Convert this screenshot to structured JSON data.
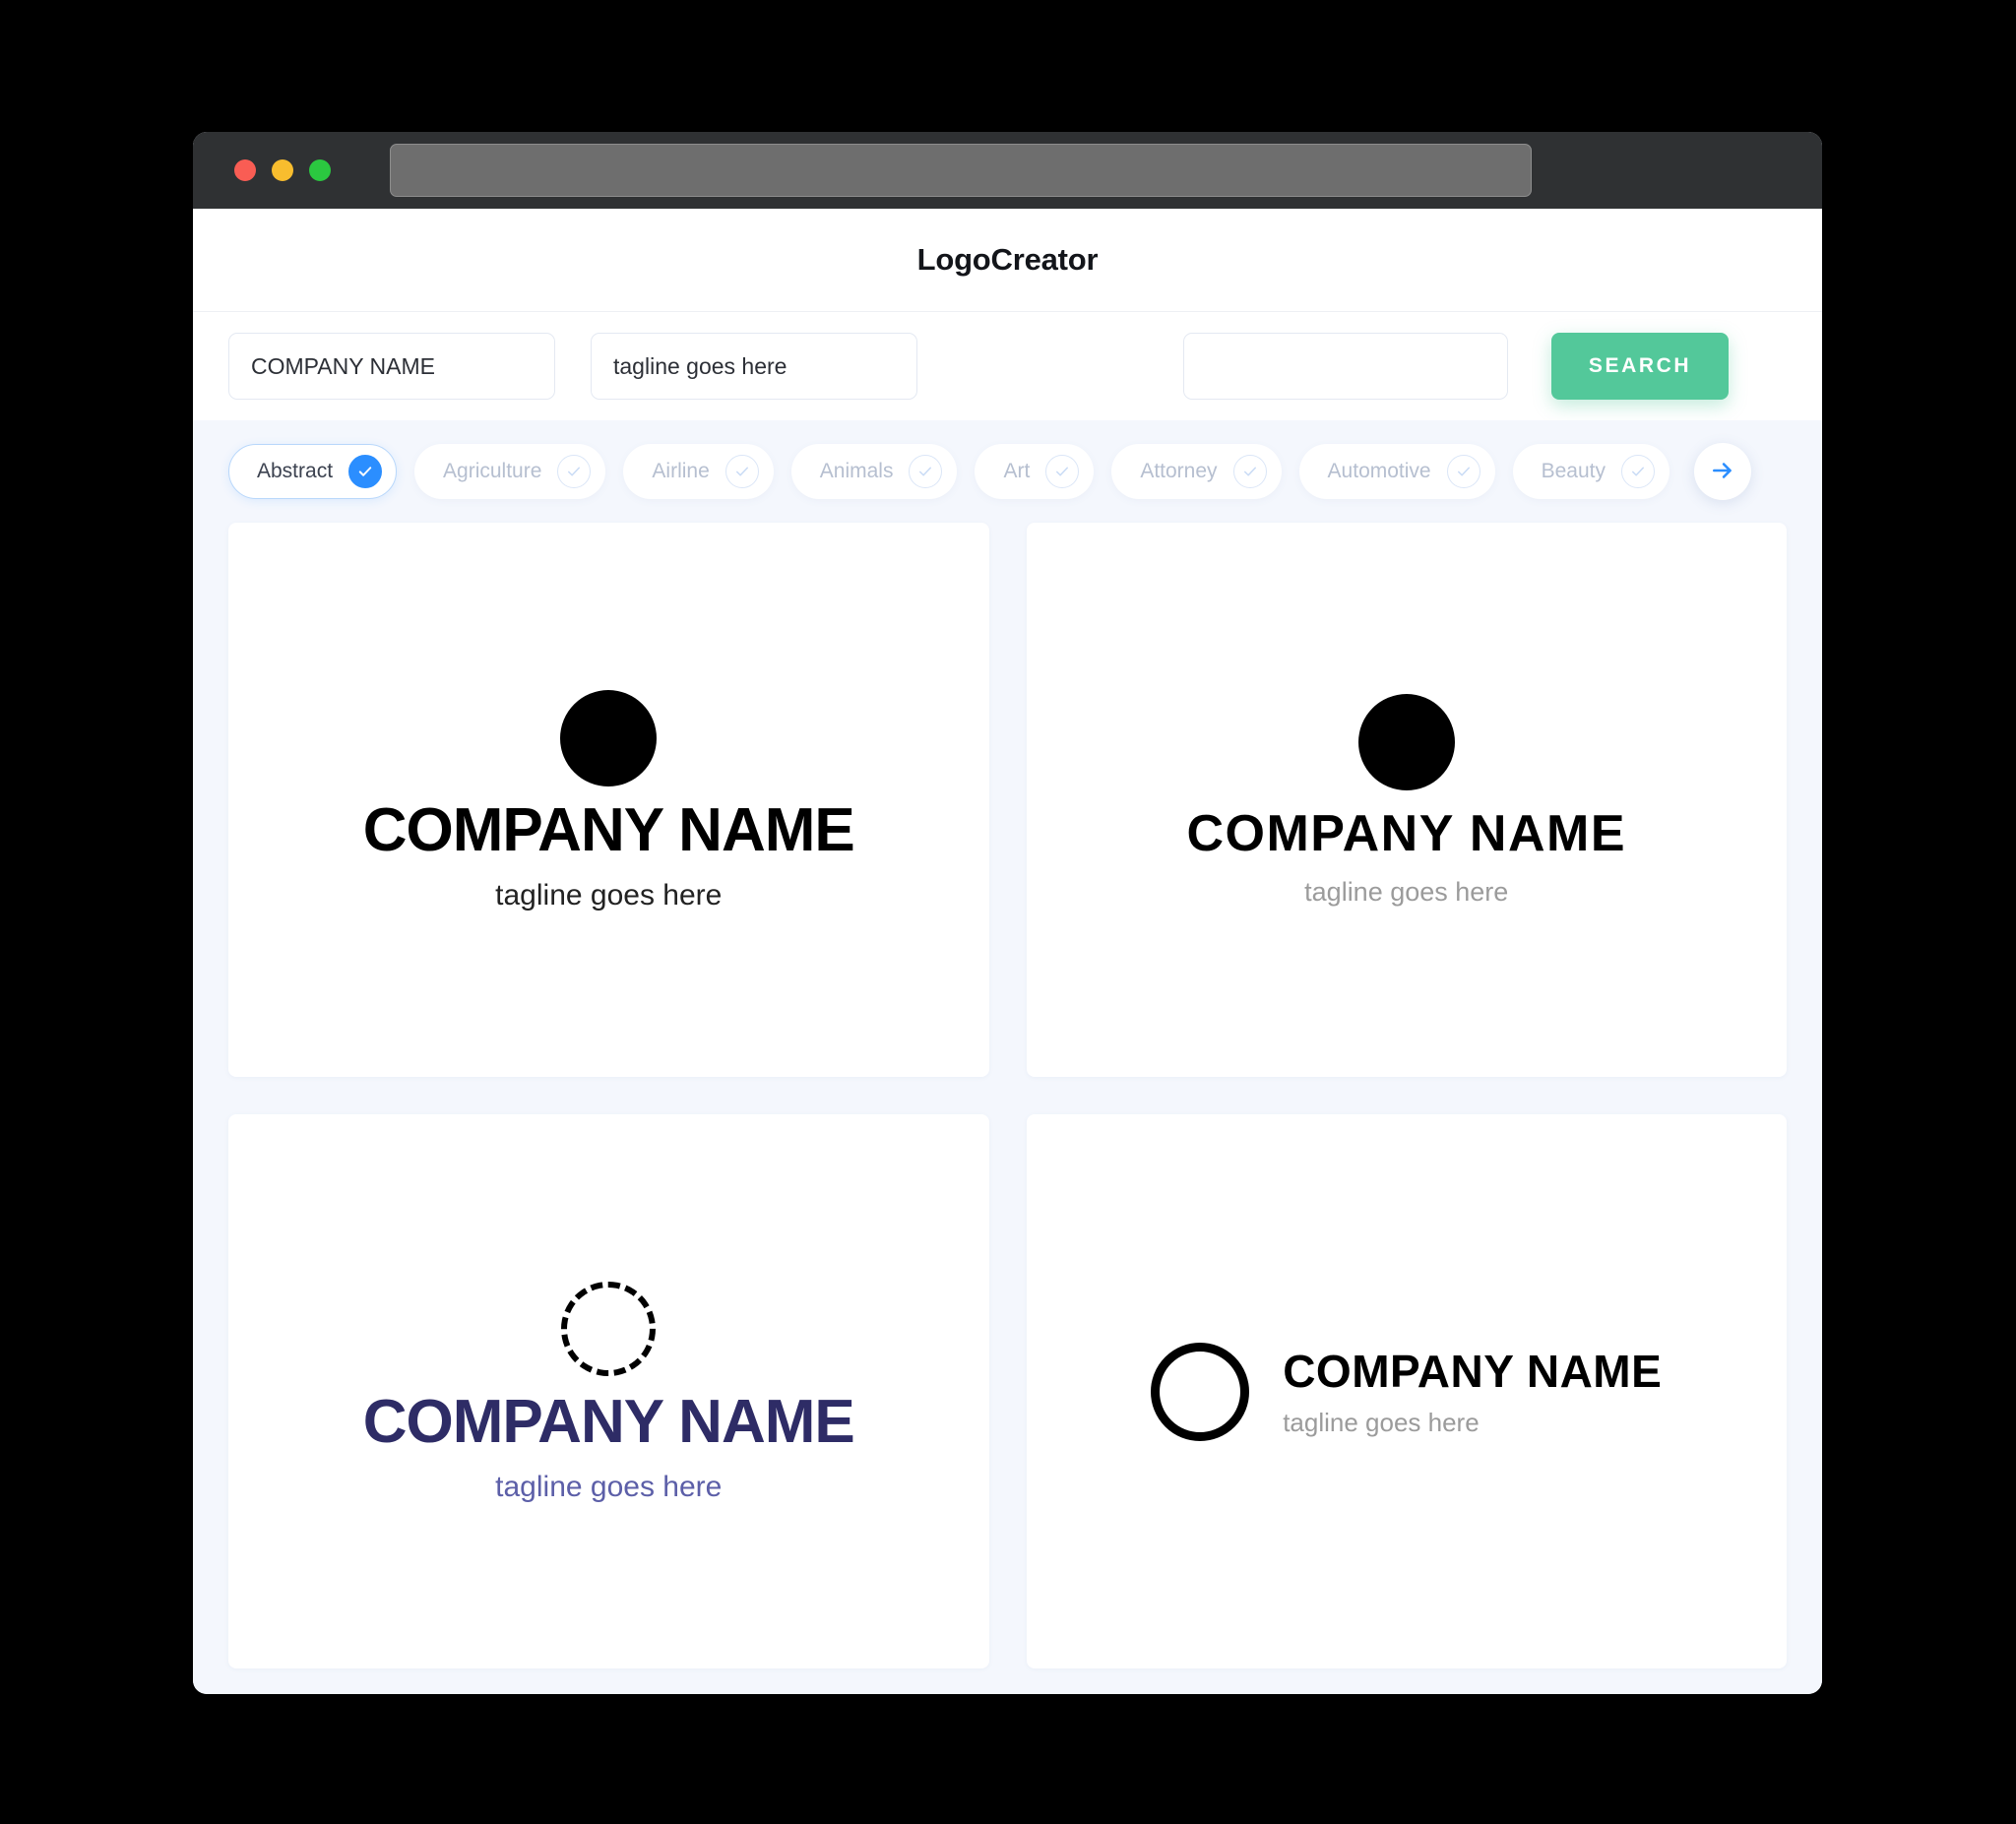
{
  "window": {
    "traffic_lights": [
      "close",
      "minimize",
      "maximize"
    ],
    "url_bar_value": ""
  },
  "header": {
    "title": "LogoCreator"
  },
  "search": {
    "company_value": "COMPANY NAME",
    "company_placeholder": "COMPANY NAME",
    "tagline_value": "tagline goes here",
    "tagline_placeholder": "tagline goes here",
    "extra_value": "",
    "extra_placeholder": "",
    "search_label": "SEARCH",
    "search_button_color": "#53c89a"
  },
  "categories": {
    "next_icon": "arrow-right-icon",
    "accent_color": "#2b8eff",
    "items": [
      {
        "label": "Abstract",
        "selected": true
      },
      {
        "label": "Agriculture",
        "selected": false
      },
      {
        "label": "Airline",
        "selected": false
      },
      {
        "label": "Animals",
        "selected": false
      },
      {
        "label": "Art",
        "selected": false
      },
      {
        "label": "Attorney",
        "selected": false
      },
      {
        "label": "Automotive",
        "selected": false
      },
      {
        "label": "Beauty",
        "selected": false
      }
    ]
  },
  "logos": [
    {
      "mark": "filled-circle-icon",
      "name": "COMPANY NAME",
      "tagline": "tagline goes here",
      "name_color": "#000000",
      "tagline_color": "#222222",
      "layout": "stacked"
    },
    {
      "mark": "filled-circle-icon",
      "name": "COMPANY NAME",
      "tagline": "tagline goes here",
      "name_color": "#000000",
      "tagline_color": "#9b9b9b",
      "layout": "stacked"
    },
    {
      "mark": "dashed-circle-icon",
      "name": "COMPANY NAME",
      "tagline": "tagline goes here",
      "name_color": "#2e2c66",
      "tagline_color": "#5c5fa8",
      "layout": "stacked"
    },
    {
      "mark": "ring-circle-icon",
      "name": "COMPANY NAME",
      "tagline": "tagline goes here",
      "name_color": "#000000",
      "tagline_color": "#9b9b9b",
      "layout": "horizontal"
    }
  ]
}
